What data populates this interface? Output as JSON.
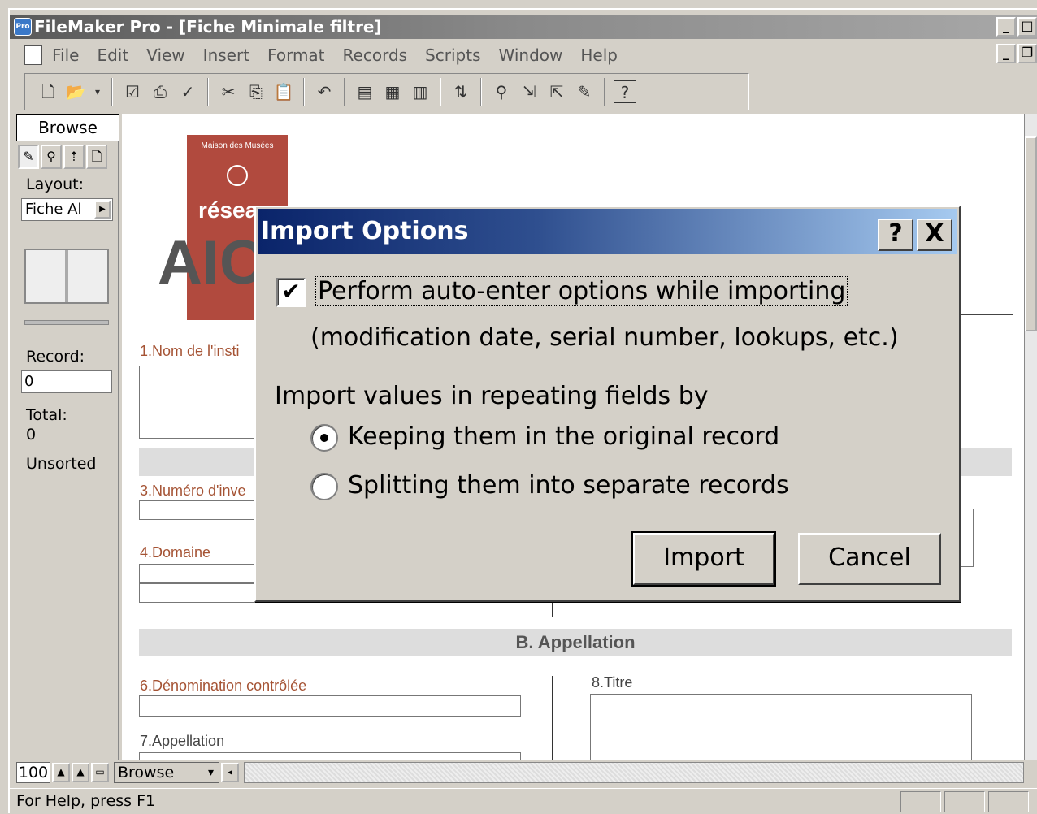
{
  "app": {
    "title": "FileMaker Pro - [Fiche Minimale filtre]",
    "icon_text": "Pro"
  },
  "menu": [
    "File",
    "Edit",
    "View",
    "Insert",
    "Format",
    "Records",
    "Scripts",
    "Window",
    "Help"
  ],
  "toolbar": {
    "icons": [
      "new-icon",
      "open-icon",
      "dropdown-icon",
      "checkbox-icon",
      "print-icon",
      "spelling-icon",
      "cut-icon",
      "copy-icon",
      "paste-icon",
      "undo-icon",
      "new-record-icon",
      "duplicate-record-icon",
      "delete-record-icon",
      "sort-icon",
      "find-icon",
      "import-icon",
      "export-icon",
      "script-icon",
      "help-icon"
    ]
  },
  "status_area": {
    "mode": "Browse",
    "layout_label": "Layout:",
    "layout_value": "Fiche Al",
    "record_label": "Record:",
    "record_value": "0",
    "total_label": "Total:",
    "total_value": "0",
    "sort_state": "Unsorted"
  },
  "form": {
    "logo_small": "Maison des Musées",
    "logo_word": "réseau",
    "logo_big": "AICI",
    "field1": "1.Nom de l'insti",
    "field3": "3.Numéro d'inve",
    "field4": "4.Domaine",
    "section_b": "B. Appellation",
    "field6": "6.Dénomination contrôlée",
    "field7": "7.Appellation",
    "field8": "8.Titre"
  },
  "bottom": {
    "zoom": "100",
    "mode_select": "Browse"
  },
  "statusbar": {
    "text": "For Help, press F1"
  },
  "dialog": {
    "title": "Import Options",
    "help_btn": "?",
    "close_btn": "X",
    "checkbox_label": "Perform auto-enter options while importing",
    "checkbox_checked": true,
    "note": "(modification date, serial number, lookups, etc.)",
    "group_label": "Import values in repeating fields by",
    "radio1": "Keeping them in the original record",
    "radio2": "Splitting them into separate records",
    "selected_radio": "radio1",
    "import_btn": "Import",
    "cancel_btn": "Cancel"
  }
}
